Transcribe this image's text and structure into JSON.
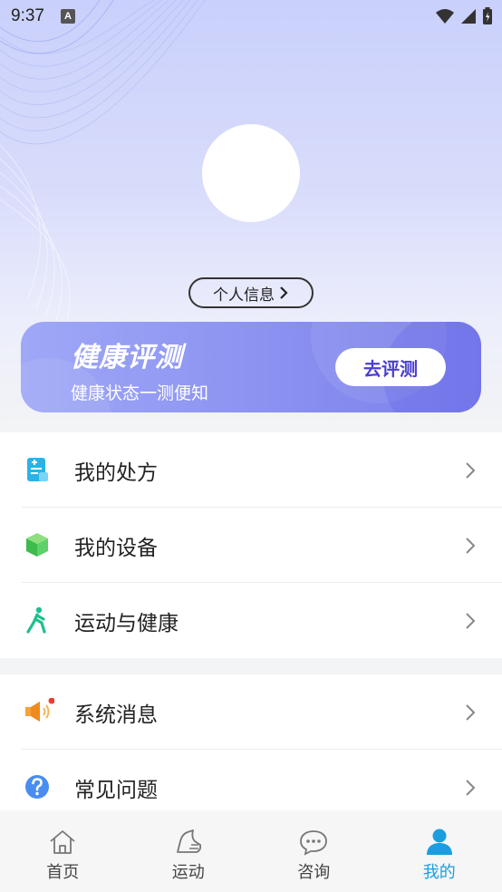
{
  "status_bar": {
    "time": "9:37",
    "indicator": "A"
  },
  "profile": {
    "info_button": "个人信息"
  },
  "assessment": {
    "title": "健康评测",
    "subtitle": "健康状态一测便知",
    "button": "去评测"
  },
  "menu_group_1": [
    {
      "label": "我的处方",
      "icon": "prescription-icon"
    },
    {
      "label": "我的设备",
      "icon": "device-cube-icon"
    },
    {
      "label": "运动与健康",
      "icon": "running-person-icon"
    }
  ],
  "menu_group_2": [
    {
      "label": "系统消息",
      "icon": "megaphone-icon"
    },
    {
      "label": "常见问题",
      "icon": "question-icon"
    }
  ],
  "tabbar": [
    {
      "label": "首页",
      "icon": "home-icon"
    },
    {
      "label": "运动",
      "icon": "sport-shoe-icon"
    },
    {
      "label": "咨询",
      "icon": "chat-icon"
    },
    {
      "label": "我的",
      "icon": "user-icon",
      "active": true
    }
  ],
  "colors": {
    "accent": "#1a9ee0",
    "card_gradient_start": "#9fa8f7",
    "card_gradient_end": "#7b7fea",
    "button_text": "#4b3fd0"
  }
}
